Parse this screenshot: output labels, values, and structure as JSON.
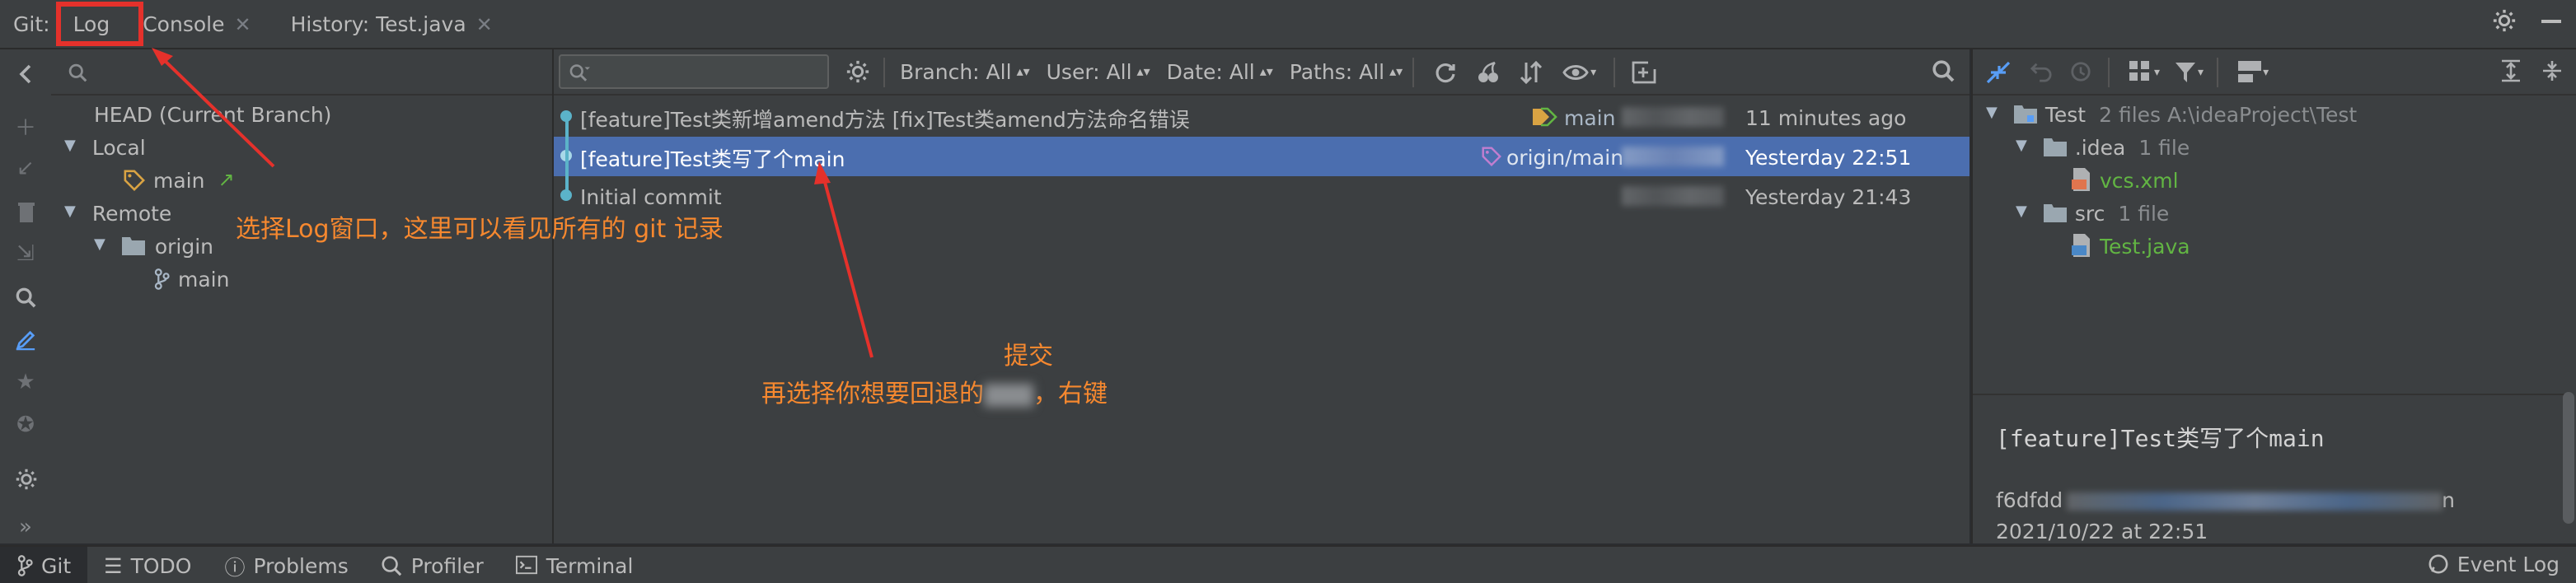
{
  "topbar": {
    "git_label": "Git:",
    "tabs": [
      {
        "label": "Log",
        "closable": false,
        "highlighted": true
      },
      {
        "label": "Console",
        "closable": true
      },
      {
        "label": "History: Test.java",
        "closable": true
      }
    ]
  },
  "branches": {
    "head_label": "HEAD (Current Branch)",
    "local_label": "Local",
    "local_branch": "main",
    "remote_label": "Remote",
    "origin_label": "origin",
    "origin_branch": "main"
  },
  "log": {
    "filters": {
      "branch": "Branch: All",
      "user": "User: All",
      "date": "Date: All",
      "paths": "Paths: All"
    },
    "commits": [
      {
        "subject": "[feature]Test类新增amend方法 [fix]Test类amend方法命名错误",
        "ref": "main",
        "date": "11 minutes ago",
        "selected": false
      },
      {
        "subject": "[feature]Test类写了个main",
        "ref": "origin/main",
        "date": "Yesterday 22:51",
        "selected": true
      },
      {
        "subject": "Initial commit",
        "ref": "",
        "date": "Yesterday 21:43",
        "selected": false
      }
    ]
  },
  "changes": {
    "root_name": "Test",
    "root_meta": "2 files  A:\\ideaProject\\Test",
    "idea_folder": ".idea",
    "idea_meta": "1 file",
    "idea_file": "vcs.xml",
    "src_folder": "src",
    "src_meta": "1 file",
    "src_file": "Test.java"
  },
  "details": {
    "title": "[feature]Test类写了个main",
    "hash_start": "f6dfdd",
    "hash_end": "n",
    "date": "2021/10/22 at 22:51"
  },
  "bottombar": {
    "tabs": [
      "Git",
      "TODO",
      "Problems",
      "Profiler",
      "Terminal"
    ],
    "event_log": "Event Log"
  },
  "annotations": {
    "select_log": "选择Log窗口，这里可以看见所有的 git 记录",
    "commit_word": "提交",
    "select_commit_prefix": "再选择你想要回退的",
    "select_commit_suffix": "，右键"
  },
  "colors": {
    "accent_selected": "#4b6eaf",
    "annotation": "#f6882f",
    "highlight_box": "#e5312b",
    "graph_node": "#5bb3c9",
    "file_green": "#62b543"
  }
}
